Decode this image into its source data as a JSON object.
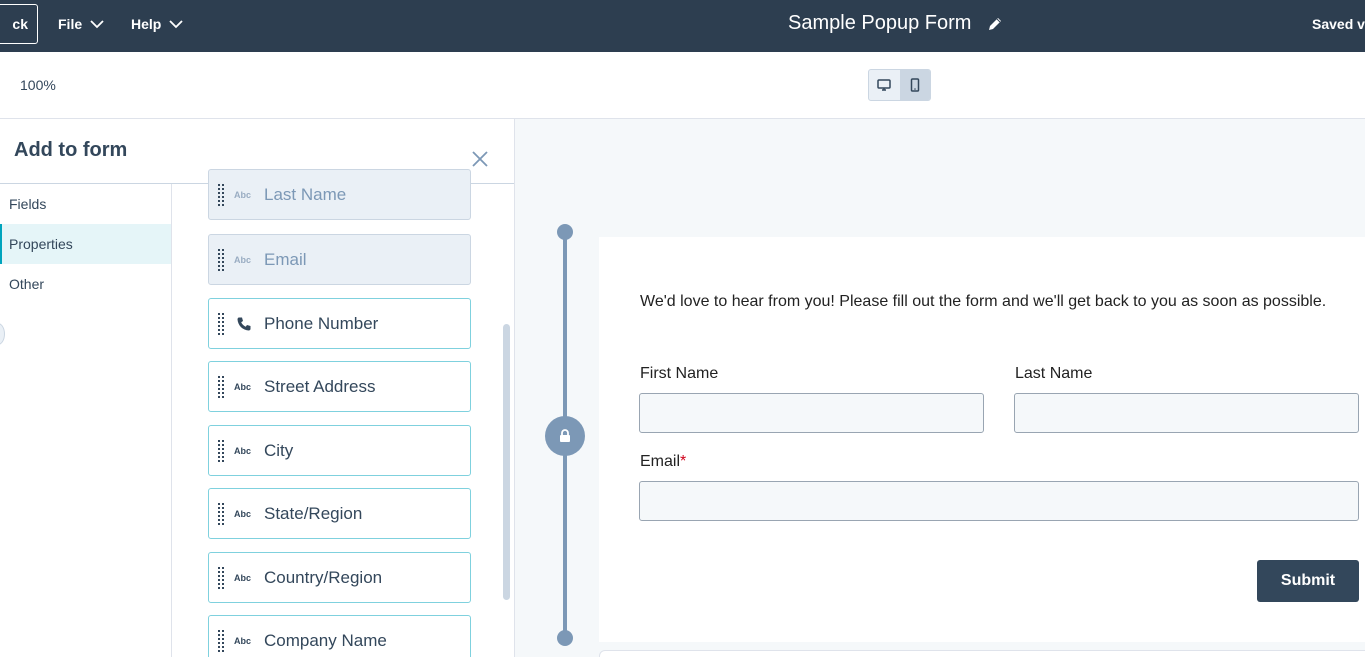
{
  "topbar": {
    "back_label": "Back",
    "file_label": "File",
    "help_label": "Help",
    "title": "Sample Popup Form",
    "saved_label": "Saved"
  },
  "toolbar": {
    "zoom": "100%"
  },
  "panel": {
    "title": "Add to form",
    "categories": [
      {
        "label": "Fields"
      },
      {
        "label": "Properties"
      },
      {
        "label": "Other"
      }
    ],
    "active_category": "Properties",
    "fields": [
      {
        "label": "Last Name",
        "icon": "abc-icon",
        "icon_text": "Abc",
        "disabled": true
      },
      {
        "label": "Email",
        "icon": "abc-icon",
        "icon_text": "Abc",
        "disabled": true
      },
      {
        "label": "Phone Number",
        "icon": "phone-icon",
        "icon_text": "",
        "disabled": false
      },
      {
        "label": "Street Address",
        "icon": "abc-icon",
        "icon_text": "Abc",
        "disabled": false
      },
      {
        "label": "City",
        "icon": "abc-icon",
        "icon_text": "Abc",
        "disabled": false
      },
      {
        "label": "State/Region",
        "icon": "abc-icon",
        "icon_text": "Abc",
        "disabled": false
      },
      {
        "label": "Country/Region",
        "icon": "abc-icon",
        "icon_text": "Abc",
        "disabled": false
      },
      {
        "label": "Company Name",
        "icon": "abc-icon",
        "icon_text": "Abc",
        "disabled": false
      }
    ]
  },
  "form": {
    "intro": "We'd love to hear from you! Please fill out the form and we'll get back to you as soon as possible.",
    "first_name_label": "First Name",
    "last_name_label": "Last Name",
    "email_label": "Email",
    "email_required_mark": "*",
    "submit_label": "Submit"
  },
  "colors": {
    "topbar_bg": "#2d3e50",
    "accent": "#00a4bd",
    "submit_bg": "#33475b",
    "required": "#d0021b"
  }
}
